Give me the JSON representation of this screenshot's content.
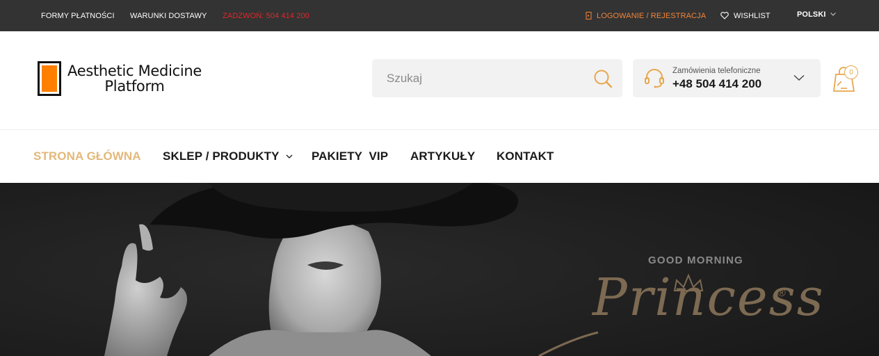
{
  "topbar": {
    "payment_forms": "FORMY PŁATNOŚCI",
    "delivery_terms": "WARUNKI DOSTAWY",
    "call": "ZADZWOŃ: 504 414 200",
    "login": "LOGOWANIE / REJESTRACJA",
    "wishlist": "WISHLIST",
    "language": "POLSKI"
  },
  "brand": {
    "line1": "Aesthetic Medicine",
    "line2": "Platform",
    "accent_color": "#ff7f00"
  },
  "search": {
    "placeholder": "Szukaj",
    "value": ""
  },
  "phone_box": {
    "label": "Zamówienia telefoniczne",
    "number": "+48 504 414 200"
  },
  "cart": {
    "count": "0"
  },
  "nav": {
    "items": [
      {
        "label": "STRONA GŁÓWNA",
        "active": true
      },
      {
        "label": "SKLEP / PRODUKTY",
        "dropdown": true
      },
      {
        "label": "PAKIETY  VIP"
      },
      {
        "label": "ARTYKUŁY"
      },
      {
        "label": "KONTAKT"
      }
    ]
  },
  "hero": {
    "tagline": "GOOD MORNING",
    "brand_name": "Princess",
    "registered": "®"
  },
  "colors": {
    "topbar_bg": "#333333",
    "nav_active": "#e3b87a",
    "icon_gold": "#e8a64b",
    "alert_red": "#e3262a"
  }
}
